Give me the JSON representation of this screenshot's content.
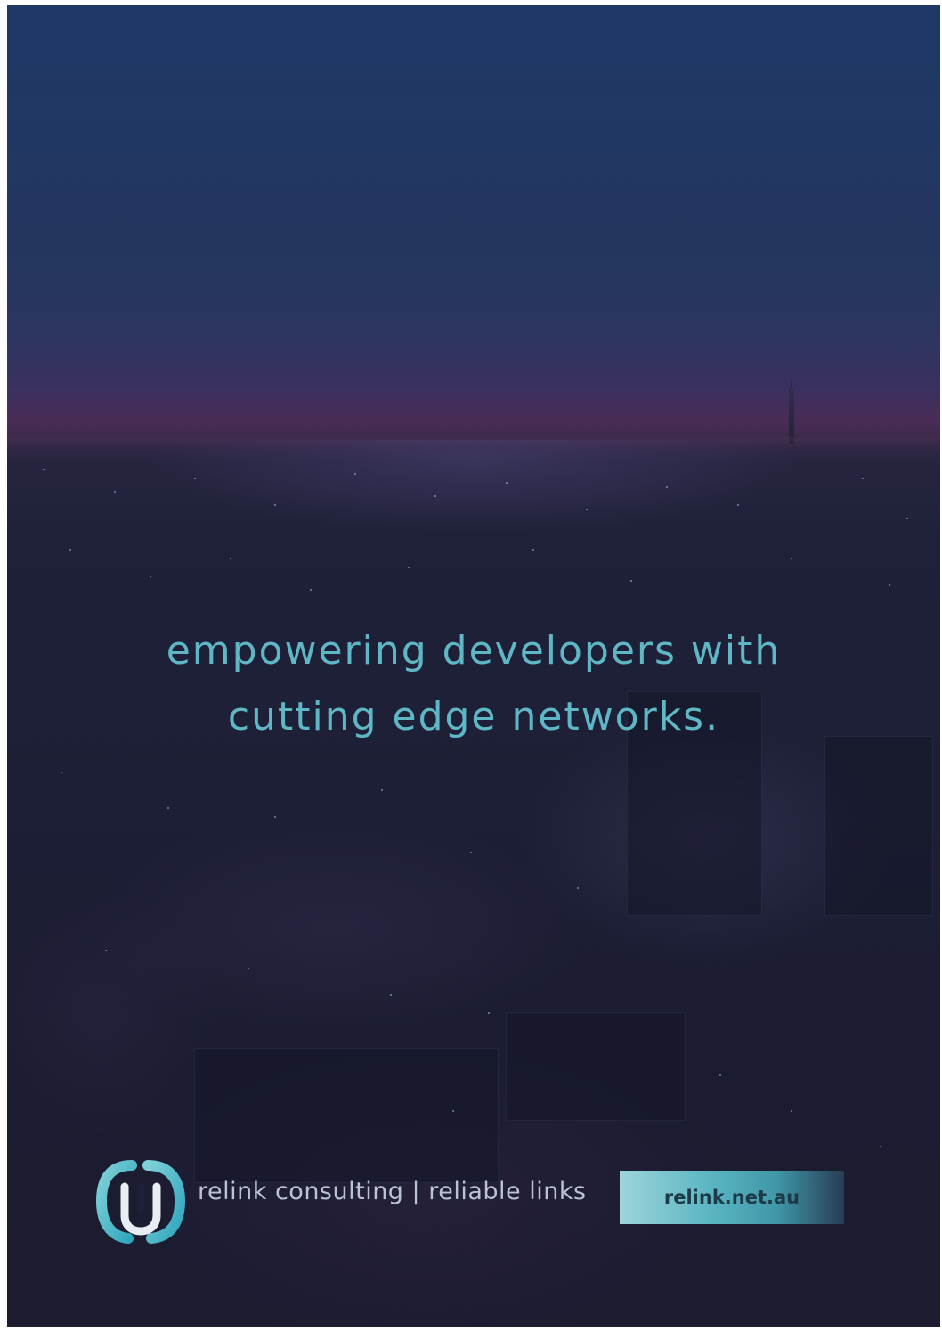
{
  "headline": {
    "line1": "empowering developers with",
    "line2": "cutting edge networks."
  },
  "footer": {
    "tagline": "relink consulting | reliable links",
    "url": "relink.net.au",
    "logo_icon": "relink-logo-icon"
  },
  "colors": {
    "headline": "#5fb7c6",
    "accent": "#3fb3c4",
    "sky_top": "#203866",
    "horizon": "#4a2c55",
    "city": "#1d1f36"
  }
}
